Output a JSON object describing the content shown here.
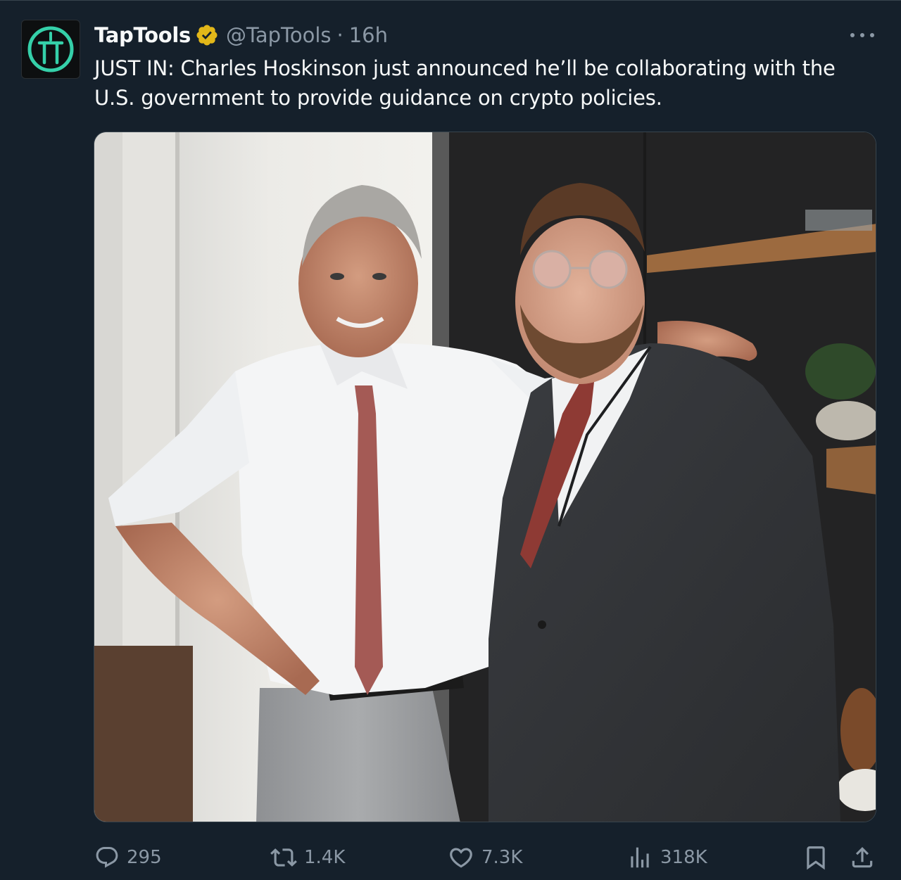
{
  "account": {
    "display_name": "TapTools",
    "handle": "@TapTools",
    "separator": "·",
    "time": "16h",
    "avatar_icon": "taptools-logo-icon",
    "verified_icon": "verified-badge-icon",
    "verified_color": "#e2b719",
    "brand_color": "#35d0a9"
  },
  "tweet": {
    "text_line1": "JUST IN: Charles Hoskinson just announced he’ll be collaborating with the",
    "text_line2": "U.S. government to provide guidance on crypto policies.",
    "media_alt": "Photo of two men posing together in a room"
  },
  "actions": {
    "reply_count": "295",
    "repost_count": "1.4K",
    "like_count": "7.3K",
    "view_count": "318K",
    "reply_icon": "reply-icon",
    "repost_icon": "repost-icon",
    "like_icon": "heart-icon",
    "view_icon": "views-chart-icon",
    "bookmark_icon": "bookmark-icon",
    "share_icon": "share-icon",
    "icon_color": "#8b98a5"
  },
  "more_icon": "more-options-icon"
}
